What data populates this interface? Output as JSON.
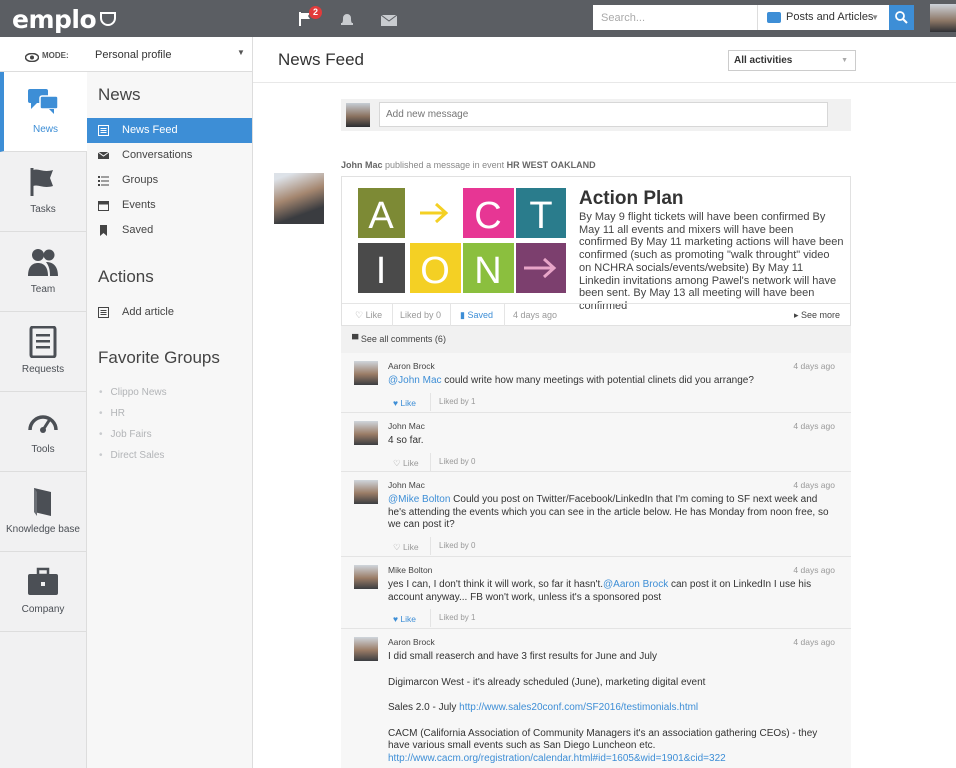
{
  "header": {
    "logo": "emplo",
    "notifications_count": "2",
    "search_placeholder": "Search...",
    "search_scope": "Posts and Articles"
  },
  "mode": {
    "label": "MODE:",
    "value": "Personal profile"
  },
  "rail": [
    {
      "label": "News",
      "icon": "chat-bubbles-icon"
    },
    {
      "label": "Tasks",
      "icon": "flag-icon"
    },
    {
      "label": "Team",
      "icon": "people-icon"
    },
    {
      "label": "Requests",
      "icon": "document-list-icon"
    },
    {
      "label": "Tools",
      "icon": "gauge-icon"
    },
    {
      "label": "Knowledge base",
      "icon": "book-icon"
    },
    {
      "label": "Company",
      "icon": "briefcase-icon"
    }
  ],
  "subnav": {
    "news_title": "News",
    "news_items": [
      "News Feed",
      "Conversations",
      "Groups",
      "Events",
      "Saved"
    ],
    "actions_title": "Actions",
    "actions_items": [
      "Add article"
    ],
    "fav_title": "Favorite Groups",
    "fav_items": [
      "Clippo News",
      "HR",
      "Job Fairs",
      "Direct Sales"
    ]
  },
  "main": {
    "title": "News Feed",
    "filter": "All activities",
    "composer_placeholder": "Add new message"
  },
  "post": {
    "author": "John Mac",
    "action": "published a message in event",
    "event": "HR WEST OAKLAND",
    "title": "Action Plan",
    "body": "By May 9 flight tickets will have been confirmed By May 11 all events and mixers will have been confirmed By May 11 marketing actions will have been confirmed (such as promoting \"walk throught\" video on NCHRA socials/events/website) By May 11 Linkedin invitations among Pawel's network will have been sent.  By May 13 all meeting will have been confirmed",
    "like": "Like",
    "liked_by": "Liked by 0",
    "saved": "Saved",
    "time": "4 days ago",
    "see_more": "See more",
    "see_all_comments": "See all comments (6)"
  },
  "comments": [
    {
      "name": "Aaron Brock",
      "time": "4 days ago",
      "mention": "@John Mac",
      "text": " could write how many meetings with potential clinets did you arrange?",
      "like": "Like",
      "liked_by": "Liked by 1",
      "liked": true
    },
    {
      "name": "John Mac",
      "time": "4 days ago",
      "text": "4 so far.",
      "like": "Like",
      "liked_by": "Liked by 0",
      "liked": false
    },
    {
      "name": "John Mac",
      "time": "4 days ago",
      "mention": "@Mike Bolton",
      "text": " Could you post on Twitter/Facebook/LinkedIn that I'm coming to SF next week and he's attending the events which you can see in the article below. He has Monday from noon free, so we can post it?",
      "like": "Like",
      "liked_by": "Liked by 0",
      "liked": false
    },
    {
      "name": "Mike Bolton",
      "time": "4 days ago",
      "text_before": "yes I can, I don't think it will work, so far it hasn't.",
      "mention": "@Aaron Brock",
      "text": " can post it on LinkedIn I use his account anyway... FB won't work, unless it's a sponsored post",
      "like": "Like",
      "liked_by": "Liked by 1",
      "liked": true
    },
    {
      "name": "Aaron Brock",
      "time": "4 days ago",
      "p1": "I did small reaserch and have 3 first results for June and July",
      "p2": "Digimarcon West - it's already scheduled (June), marketing digital event",
      "p3_prefix": "Sales 2.0 - July ",
      "p3_link": "http://www.sales20conf.com/SF2016/testimonials.html",
      "p4": "CACM (California Association of Community Managers it's an association gathering CEOs) - they have various small events such as San Diego Luncheon etc.",
      "p4_link": "http://www.cacm.org/registration/calendar.html#id=1605&wid=1901&cid=322"
    }
  ],
  "action_image_letters": [
    "A",
    "C",
    "T",
    "I",
    "O",
    "N"
  ]
}
